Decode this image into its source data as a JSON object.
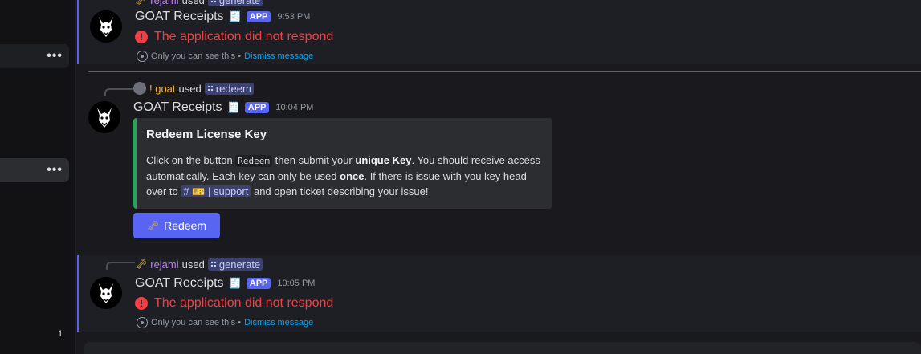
{
  "sidebar": {
    "row1_menu": "•••",
    "row2_menu": "•••",
    "badge": "1"
  },
  "message1": {
    "reply_user": "rejami",
    "reply_used": "used",
    "reply_command": "generate",
    "bot_name": "GOAT Receipts",
    "bot_emoji": "🧾",
    "app_tag": "APP",
    "timestamp": "9:53 PM",
    "error_text": "The application did not respond",
    "ephemeral_note": "Only you can see this •",
    "dismiss": "Dismiss message"
  },
  "message2": {
    "reply_user": "! goat",
    "reply_used": "used",
    "reply_command": "redeem",
    "bot_name": "GOAT Receipts",
    "bot_emoji": "🧾",
    "app_tag": "APP",
    "timestamp": "10:04 PM",
    "embed": {
      "title": "Redeem License Key",
      "p1": "Click on the button ",
      "code": "Redeem",
      "p2": " then submit your ",
      "b1": "unique Key",
      "p3": ". You should receive access automatically. Each key can only be used ",
      "b2": "once",
      "p4": ". If there is issue with you key head over to ",
      "channel": "# 🎫 | support",
      "p5": " and open ticket describing your issue!"
    },
    "button_label": "Redeem"
  },
  "message3": {
    "reply_user": "rejami",
    "reply_used": "used",
    "reply_command": "generate",
    "bot_name": "GOAT Receipts",
    "bot_emoji": "🧾",
    "app_tag": "APP",
    "timestamp": "10:05 PM",
    "error_text": "The application did not respond",
    "ephemeral_note": "Only you can see this •",
    "dismiss": "Dismiss message"
  },
  "colors": {
    "accent": "#5865f2",
    "error": "#f23f43",
    "embed_border": "#23a55a",
    "link": "#00a8fc"
  }
}
